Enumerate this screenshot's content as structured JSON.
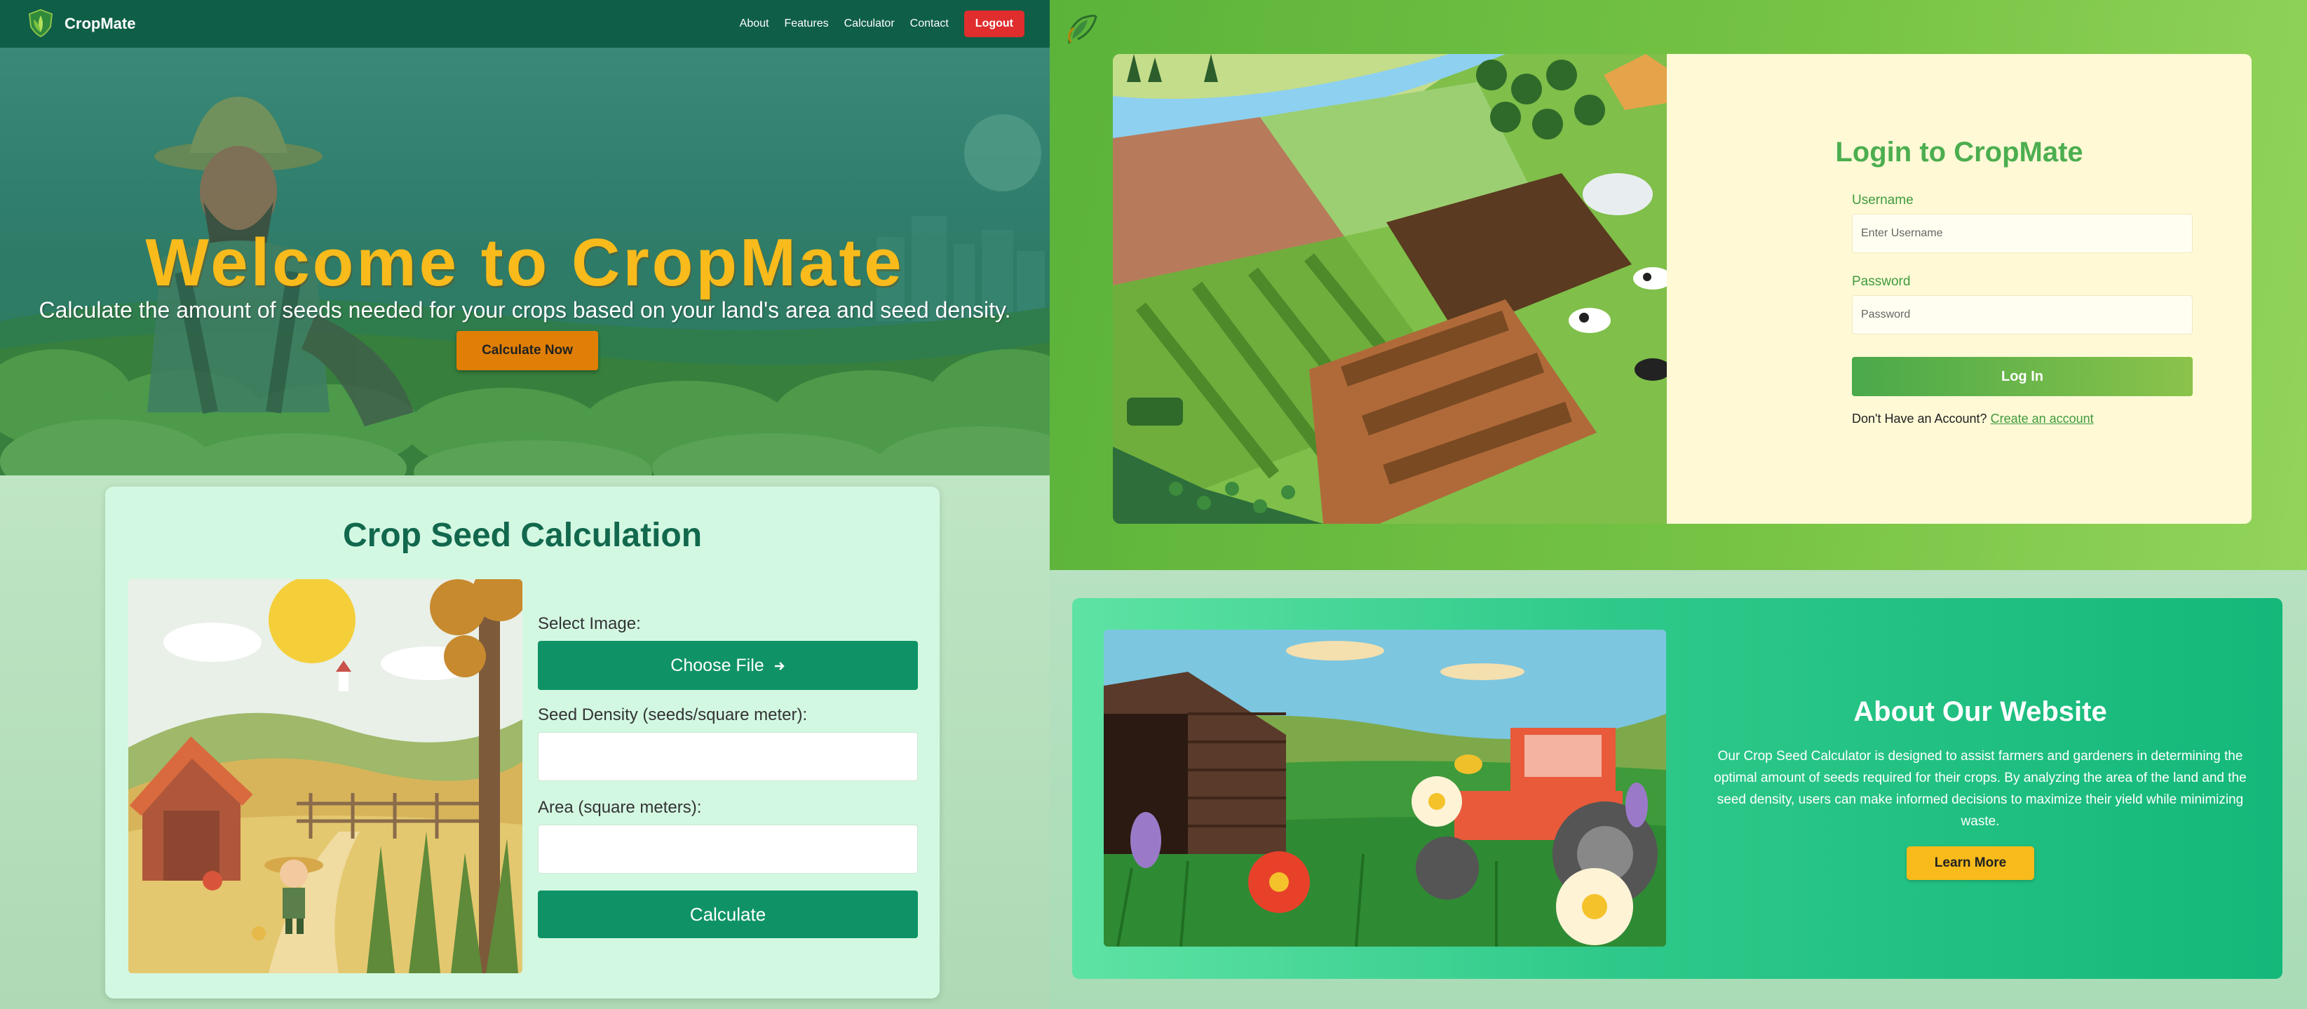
{
  "hero": {
    "brand": "CropMate",
    "nav": [
      "About",
      "Features",
      "Calculator",
      "Contact"
    ],
    "logout": "Logout",
    "title": "Welcome to CropMate",
    "subtitle": "Calculate the amount of seeds needed for your crops based on your land's area and seed density.",
    "cta": "Calculate Now"
  },
  "calculator": {
    "title": "Crop Seed Calculation",
    "image_label": "Select Image:",
    "choose_file": "Choose File",
    "density_label": "Seed Density (seeds/square meter):",
    "density_value": "",
    "area_label": "Area (square meters):",
    "area_value": "",
    "calculate": "Calculate"
  },
  "login": {
    "title": "Login to CropMate",
    "username_label": "Username",
    "username_placeholder": "Enter Username",
    "password_label": "Password",
    "password_placeholder": "Password",
    "login_button": "Log In",
    "no_account": "Don't Have an Account?",
    "create_account": "Create an account"
  },
  "about": {
    "title": "About Our Website",
    "text": "Our Crop Seed Calculator is designed to assist farmers and gardeners in determining the optimal amount of seeds required for their crops. By analyzing the area of the land and the seed density, users can make informed decisions to maximize their yield while minimizing waste.",
    "button": "Learn More"
  },
  "colors": {
    "nav_bg": "#0f5e48",
    "hero_title": "#f8bb1b",
    "cta": "#e07f05",
    "logout": "#e02d2d",
    "primary_green": "#0f9366",
    "login_green": "#4cae4f",
    "learn_more": "#f8bb1b"
  },
  "icons": [
    "leaf-logo-icon",
    "arrow-right-icon"
  ]
}
